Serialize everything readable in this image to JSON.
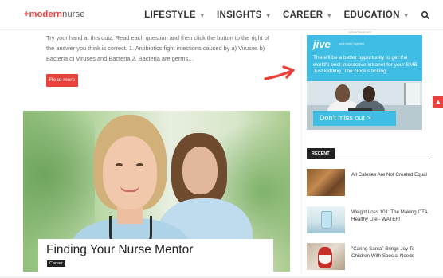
{
  "header": {
    "logo": {
      "plus": "+",
      "modern": "modern",
      "nurse": "nurse"
    },
    "nav": [
      {
        "label": "LIFESTYLE",
        "icon": "chevron-down-icon"
      },
      {
        "label": "INSIGHTS",
        "icon": "chevron-down-icon"
      },
      {
        "label": "CAREER",
        "icon": "chevron-down-icon"
      },
      {
        "label": "EDUCATION",
        "icon": "chevron-down-icon"
      }
    ],
    "search_icon": "search-icon"
  },
  "main": {
    "excerpt": "Try your hand at this quiz. Read each question and then click the button to the right of the answer you think is correct. 1.   Antibiotics fight infections caused by a) Viruses b) Bacteria c) Viruses and Bacteria 2.   Bacteria are germs…",
    "read_more": "Read more",
    "featured_post": {
      "title": "Finding Your Nurse Mentor",
      "category": "Career"
    }
  },
  "sidebar": {
    "ad_label": "Advertisement",
    "ad": {
      "logo": "jive",
      "small_text": "work better together",
      "headline": "There'll be a better opportunity to get the world's best interactive intranet for your SMB. Just kidding. The clock's ticking.",
      "cta": "Don't miss out >"
    },
    "recent_title": "RECENT",
    "recent": [
      {
        "title": "All Calories Are Not Created Equal"
      },
      {
        "title": "Weight Loss 101: The Making OTA Healthy Life - WATER!"
      },
      {
        "title": "\"Caring Santa\" Brings Joy To Children With Special Needs"
      }
    ]
  },
  "scroll_top_icon": "chevron-up-icon",
  "colors": {
    "accent": "#e8413c",
    "ad_blue": "#3fbde4",
    "dark": "#222222"
  }
}
